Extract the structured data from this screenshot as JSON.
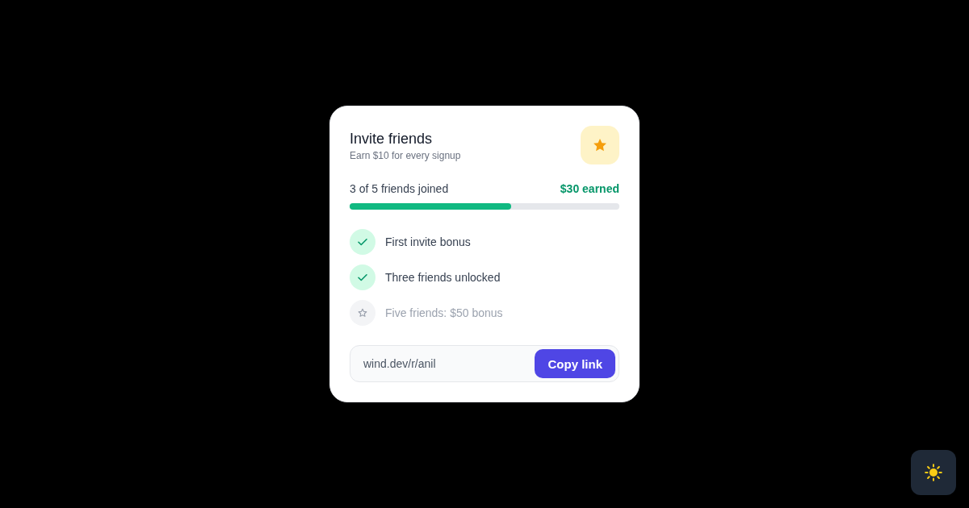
{
  "card": {
    "title": "Invite friends",
    "subtitle": "Earn $10 for every signup"
  },
  "progress": {
    "label": "3 of 5 friends joined",
    "reward": "$30 earned",
    "level": 0.6
  },
  "milestones": [
    {
      "label": "First invite bonus",
      "done": true
    },
    {
      "label": "Three friends unlocked",
      "done": true
    },
    {
      "label": "Five friends: $50 bonus",
      "done": false
    }
  ],
  "referral": {
    "value": "wind.dev/r/anil",
    "button": "Copy link"
  }
}
